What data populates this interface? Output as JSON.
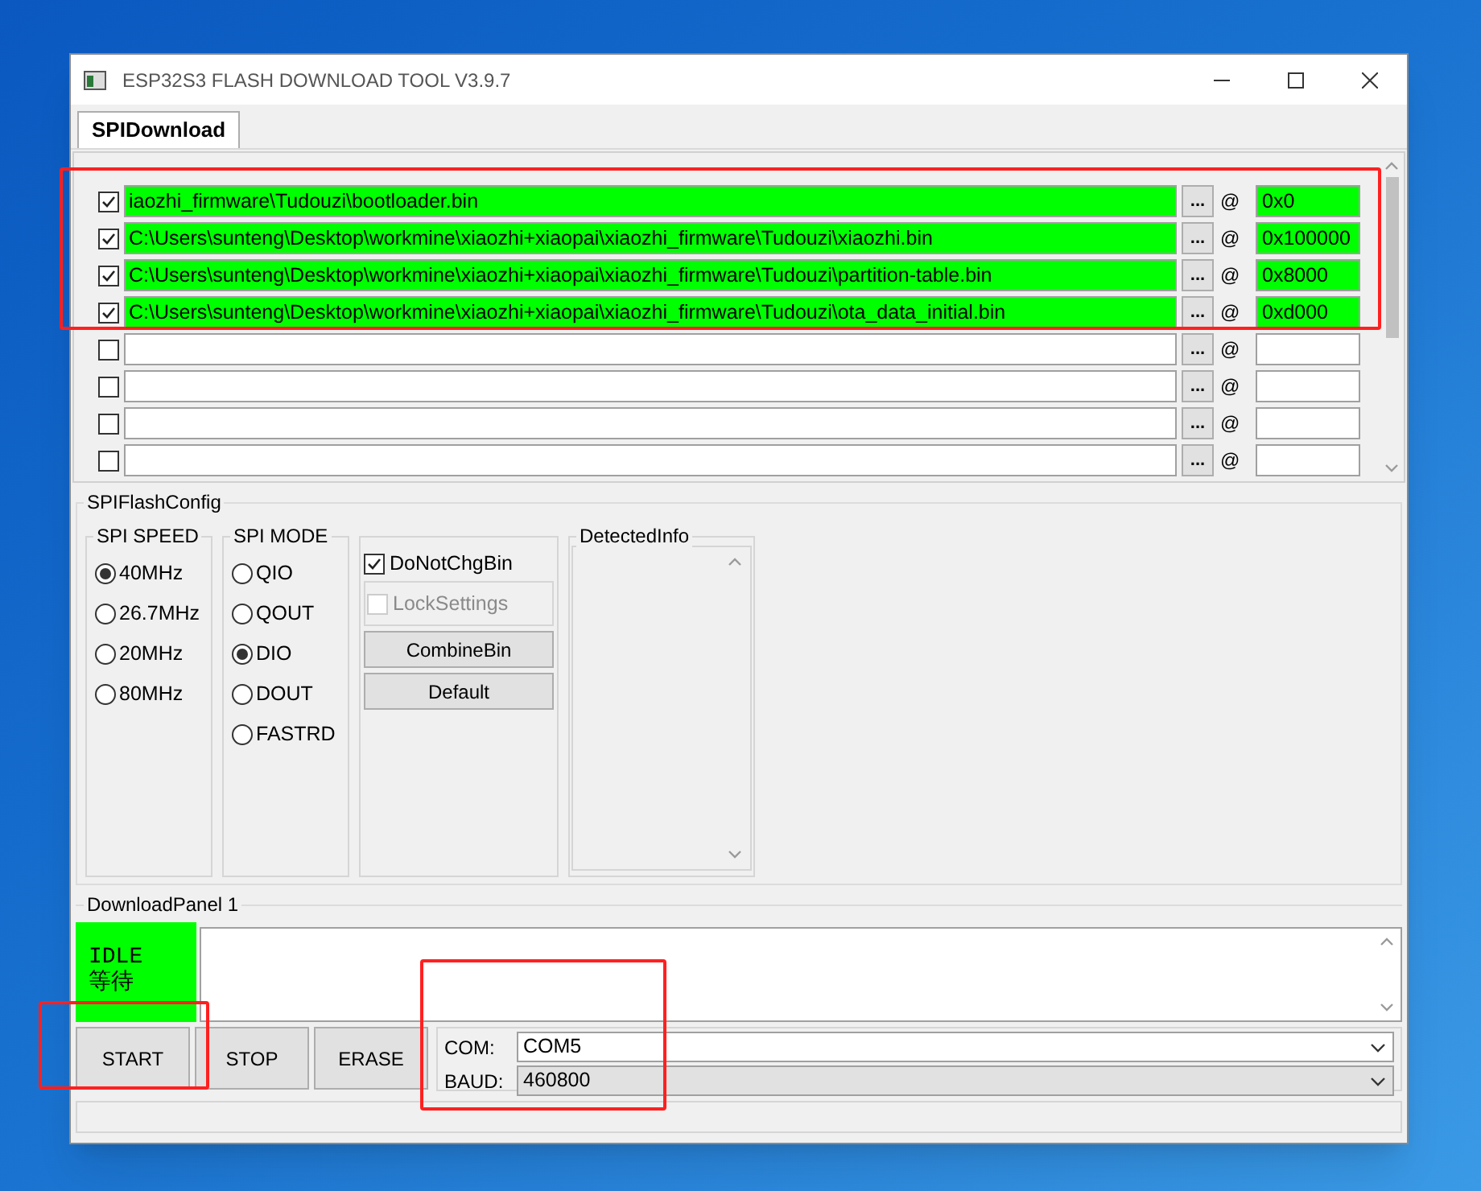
{
  "window": {
    "title": "ESP32S3 FLASH DOWNLOAD TOOL V3.9.7"
  },
  "tabs": [
    {
      "label": "SPIDownload",
      "selected": true
    }
  ],
  "files": [
    {
      "checked": true,
      "path": "iaozhi_firmware\\Tudouzi\\bootloader.bin",
      "browse": "...",
      "at": "@",
      "address": "0x0"
    },
    {
      "checked": true,
      "path": "C:\\Users\\sunteng\\Desktop\\workmine\\xiaozhi+xiaopai\\xiaozhi_firmware\\Tudouzi\\xiaozhi.bin",
      "browse": "...",
      "at": "@",
      "address": "0x100000"
    },
    {
      "checked": true,
      "path": "C:\\Users\\sunteng\\Desktop\\workmine\\xiaozhi+xiaopai\\xiaozhi_firmware\\Tudouzi\\partition-table.bin",
      "browse": "...",
      "at": "@",
      "address": "0x8000"
    },
    {
      "checked": true,
      "path": "C:\\Users\\sunteng\\Desktop\\workmine\\xiaozhi+xiaopai\\xiaozhi_firmware\\Tudouzi\\ota_data_initial.bin",
      "browse": "...",
      "at": "@",
      "address": "0xd000"
    },
    {
      "checked": false,
      "browse": "...",
      "at": "@"
    },
    {
      "checked": false,
      "browse": "...",
      "at": "@"
    },
    {
      "checked": false,
      "browse": "...",
      "at": "@"
    },
    {
      "checked": false,
      "browse": "...",
      "at": "@"
    }
  ],
  "spi_flash_config": {
    "title": "SPIFlashConfig",
    "spi_speed": {
      "title": "SPI SPEED",
      "options": [
        {
          "label": "40MHz",
          "selected": true
        },
        {
          "label": "26.7MHz",
          "selected": false
        },
        {
          "label": "20MHz",
          "selected": false
        },
        {
          "label": "80MHz",
          "selected": false
        }
      ]
    },
    "spi_mode": {
      "title": "SPI MODE",
      "options": [
        {
          "label": "QIO",
          "selected": false
        },
        {
          "label": "QOUT",
          "selected": false
        },
        {
          "label": "DIO",
          "selected": true
        },
        {
          "label": "DOUT",
          "selected": false
        },
        {
          "label": "FASTRD",
          "selected": false
        }
      ]
    },
    "do_not_chg_bin": {
      "label": "DoNotChgBin",
      "checked": true
    },
    "lock_settings": {
      "label": "LockSettings",
      "checked": false,
      "disabled": true
    },
    "buttons": [
      "CombineBin",
      "Default"
    ],
    "detected_info": {
      "title": "DetectedInfo"
    }
  },
  "download_panel": {
    "title": "DownloadPanel 1",
    "status": [
      "IDLE",
      "等待"
    ],
    "buttons": [
      "START",
      "STOP",
      "ERASE"
    ],
    "com": {
      "label": "COM:",
      "value": "COM5"
    },
    "baud": {
      "label": "BAUD:",
      "value": "460800"
    }
  }
}
